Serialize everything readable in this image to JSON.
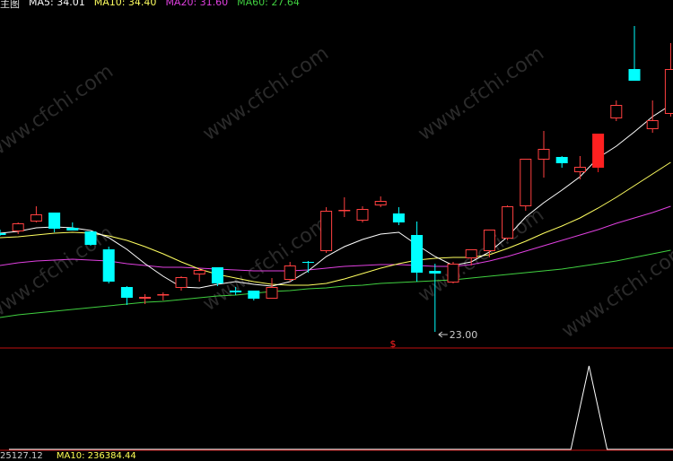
{
  "header": {
    "panel_label": "主图",
    "ma5_label": "MA5: 34.01",
    "ma10_label": "MA10: 34.40",
    "ma20_label": "MA20: 31.60",
    "ma60_label": "MA60: 27.64"
  },
  "watermark": "www.cfchi.com",
  "low_annotation": "23.00",
  "signal_marker": "$",
  "footer": {
    "left_text": "25127.12",
    "ma_text": "MA10: 236384.44"
  },
  "colors": {
    "up": "#ff4040",
    "down": "#00ffff",
    "ma5": "#ffffff",
    "ma10": "#ffff60",
    "ma20": "#e040e0",
    "ma60": "#40d040",
    "signal": "#ff2020",
    "separator": "#c01010"
  },
  "chart_data": {
    "type": "candlestick",
    "candles": [
      {
        "o": 34.0,
        "h": 34.4,
        "l": 33.7,
        "c": 33.8
      },
      {
        "o": 34.2,
        "h": 35.2,
        "l": 33.9,
        "c": 35.1
      },
      {
        "o": 35.3,
        "h": 37.0,
        "l": 35.2,
        "c": 36.1
      },
      {
        "o": 36.3,
        "h": 36.3,
        "l": 34.1,
        "c": 34.5
      },
      {
        "o": 34.6,
        "h": 35.2,
        "l": 34.3,
        "c": 34.3
      },
      {
        "o": 34.2,
        "h": 34.2,
        "l": 32.6,
        "c": 32.7
      },
      {
        "o": 32.2,
        "h": 32.5,
        "l": 28.4,
        "c": 28.6
      },
      {
        "o": 28.0,
        "h": 28.1,
        "l": 26.0,
        "c": 26.8
      },
      {
        "o": 26.7,
        "h": 27.2,
        "l": 26.1,
        "c": 26.9
      },
      {
        "o": 27.2,
        "h": 27.4,
        "l": 26.5,
        "c": 27.2
      },
      {
        "o": 27.9,
        "h": 29.2,
        "l": 27.6,
        "c": 29.1
      },
      {
        "o": 29.4,
        "h": 30.1,
        "l": 28.6,
        "c": 29.9
      },
      {
        "o": 30.2,
        "h": 30.2,
        "l": 28.1,
        "c": 28.4
      },
      {
        "o": 27.6,
        "h": 28.0,
        "l": 27.1,
        "c": 27.4
      },
      {
        "o": 27.6,
        "h": 27.6,
        "l": 26.5,
        "c": 26.7
      },
      {
        "o": 26.7,
        "h": 29.0,
        "l": 26.7,
        "c": 28.0
      },
      {
        "o": 28.8,
        "h": 30.8,
        "l": 28.6,
        "c": 30.4
      },
      {
        "o": 30.8,
        "h": 30.9,
        "l": 29.6,
        "c": 30.7
      },
      {
        "o": 32.0,
        "h": 36.9,
        "l": 31.8,
        "c": 36.5
      },
      {
        "o": 36.5,
        "h": 38.0,
        "l": 35.8,
        "c": 36.6
      },
      {
        "o": 35.4,
        "h": 37.0,
        "l": 35.2,
        "c": 36.7
      },
      {
        "o": 37.1,
        "h": 38.1,
        "l": 36.9,
        "c": 37.6
      },
      {
        "o": 36.2,
        "h": 36.9,
        "l": 34.9,
        "c": 35.2
      },
      {
        "o": 33.8,
        "h": 35.3,
        "l": 28.6,
        "c": 29.6
      },
      {
        "o": 29.8,
        "h": 30.6,
        "l": 23.0,
        "c": 29.5
      },
      {
        "o": 28.5,
        "h": 30.8,
        "l": 28.4,
        "c": 30.6
      },
      {
        "o": 31.2,
        "h": 31.3,
        "l": 30.4,
        "c": 32.2
      },
      {
        "o": 32.0,
        "h": 33.6,
        "l": 31.3,
        "c": 34.4
      },
      {
        "o": 33.4,
        "h": 37.1,
        "l": 33.2,
        "c": 37.0
      },
      {
        "o": 37.0,
        "h": 40.8,
        "l": 36.5,
        "c": 42.3
      },
      {
        "o": 42.2,
        "h": 45.4,
        "l": 40.2,
        "c": 43.4
      },
      {
        "o": 42.5,
        "h": 42.6,
        "l": 41.3,
        "c": 41.8
      },
      {
        "o": 40.8,
        "h": 42.6,
        "l": 40.0,
        "c": 41.4
      },
      {
        "o": 41.3,
        "h": 45.1,
        "l": 40.8,
        "c": 45.1
      },
      {
        "o": 46.8,
        "h": 48.8,
        "l": 46.5,
        "c": 48.3
      },
      {
        "o": 52.3,
        "h": 57.1,
        "l": 51.4,
        "c": 51.0
      },
      {
        "o": 45.6,
        "h": 48.8,
        "l": 45.2,
        "c": 46.6
      },
      {
        "o": 47.3,
        "h": 55.2,
        "l": 47.0,
        "c": 52.3
      }
    ],
    "ma5": [
      34.0,
      34.2,
      34.6,
      34.7,
      34.6,
      34.3,
      33.5,
      32.2,
      30.6,
      29.2,
      28.0,
      27.9,
      28.3,
      28.6,
      28.3,
      28.1,
      28.6,
      29.8,
      31.4,
      32.5,
      33.3,
      33.9,
      34.1,
      32.7,
      31.4,
      30.4,
      30.8,
      31.9,
      33.6,
      35.8,
      37.4,
      38.8,
      40.3,
      42.4,
      43.7,
      45.3,
      47.0,
      48.3
    ],
    "ma10": [
      33.5,
      33.6,
      33.8,
      34.0,
      34.1,
      34.0,
      33.7,
      33.2,
      32.5,
      31.7,
      30.8,
      30.0,
      29.4,
      29.0,
      28.6,
      28.3,
      28.2,
      28.2,
      28.4,
      28.9,
      29.5,
      30.1,
      30.6,
      31.0,
      31.2,
      31.3,
      31.3,
      31.6,
      32.3,
      33.1,
      34.0,
      34.8,
      35.7,
      36.8,
      38.0,
      39.3,
      40.6,
      41.9
    ],
    "ma20": [
      30.4,
      30.7,
      30.9,
      31.0,
      31.1,
      31.0,
      30.9,
      30.6,
      30.4,
      30.2,
      30.2,
      30.1,
      30.0,
      29.9,
      29.8,
      29.8,
      29.8,
      29.9,
      30.1,
      30.3,
      30.4,
      30.5,
      30.5,
      30.4,
      30.3,
      30.3,
      30.5,
      30.9,
      31.4,
      32.0,
      32.6,
      33.2,
      33.8,
      34.4,
      35.1,
      35.7,
      36.3,
      37.0
    ],
    "ma60": [
      24.6,
      24.9,
      25.1,
      25.3,
      25.5,
      25.7,
      25.9,
      26.1,
      26.3,
      26.4,
      26.6,
      26.8,
      27.0,
      27.1,
      27.3,
      27.5,
      27.6,
      27.8,
      27.9,
      28.1,
      28.2,
      28.4,
      28.5,
      28.6,
      28.7,
      28.8,
      29.0,
      29.2,
      29.4,
      29.6,
      29.8,
      30.0,
      30.3,
      30.6,
      30.9,
      31.3,
      31.7,
      32.1
    ],
    "signal_index": 33,
    "volume_signal": [
      0,
      0,
      0,
      0,
      0,
      0,
      0,
      0,
      0,
      0,
      0,
      0,
      0,
      0,
      0,
      0,
      0,
      0,
      0,
      0,
      0,
      0,
      0,
      0,
      0,
      0,
      0,
      0,
      0,
      0,
      0,
      0,
      1,
      0,
      0,
      0,
      0,
      0
    ],
    "ylim": [
      21.5,
      59.0
    ]
  }
}
